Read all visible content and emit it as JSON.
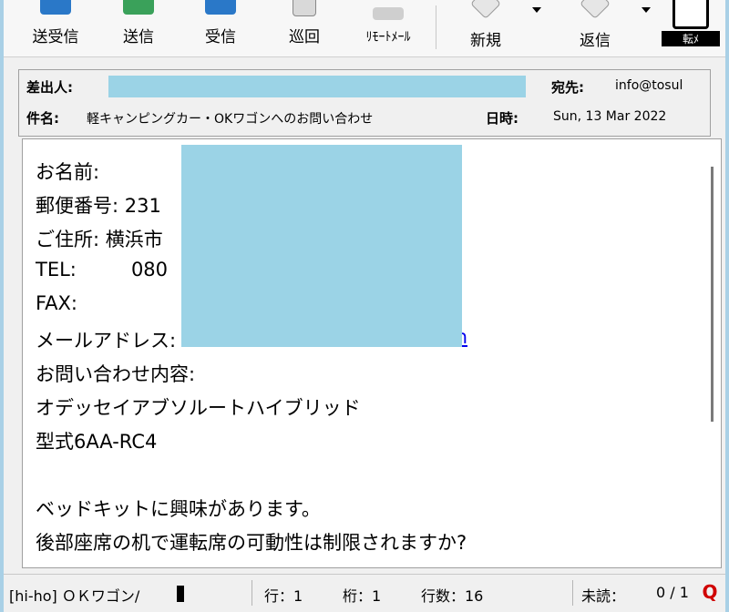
{
  "toolbar": {
    "buttons": [
      {
        "label": "送受信",
        "icon": "send-receive-icon"
      },
      {
        "label": "送信",
        "icon": "send-icon"
      },
      {
        "label": "受信",
        "icon": "receive-icon"
      },
      {
        "label": "巡回",
        "icon": "patrol-icon"
      },
      {
        "label": "ﾘﾓｰﾄﾒｰﾙ",
        "icon": "remote-mail-icon"
      },
      {
        "label": "新規",
        "icon": "new-mail-icon"
      },
      {
        "label": "返信",
        "icon": "reply-icon"
      },
      {
        "label": "転ﾒ",
        "icon": "forward-icon"
      }
    ],
    "colors": {
      "icon_blue": "#2a78c8",
      "icon_green": "#3aa15a"
    }
  },
  "header": {
    "from_label": "差出人:",
    "to_label": "宛先:",
    "to_value": "info@tosul",
    "subject_label": "件名:",
    "subject_value": "軽キャンピングカー・OKワゴンへのお問い合わせ",
    "date_label": "日時:",
    "date_value": "Sun, 13 Mar 2022"
  },
  "body": {
    "lines": [
      "お名前:",
      "郵便番号: 231",
      "ご住所: 横浜市",
      "TEL:         080",
      "FAX:",
      "メールアドレス:",
      "お問い合わせ内容:",
      "オデッセイアブソルートハイブリッド",
      "型式6AA-RC4",
      "",
      "ベッドキットに興味があります。",
      "後部座席の机で運転席の可動性は制限されますか?"
    ],
    "email_link_tail": "n",
    "redaction_color": "#9bd3e6"
  },
  "statusbar": {
    "folder": "[hi-ho] ＯＫワゴン/",
    "line": "行：1",
    "column": "桁：1",
    "line_count": "行数：16",
    "unread": "未読：",
    "unread_count": "0 / 1"
  }
}
